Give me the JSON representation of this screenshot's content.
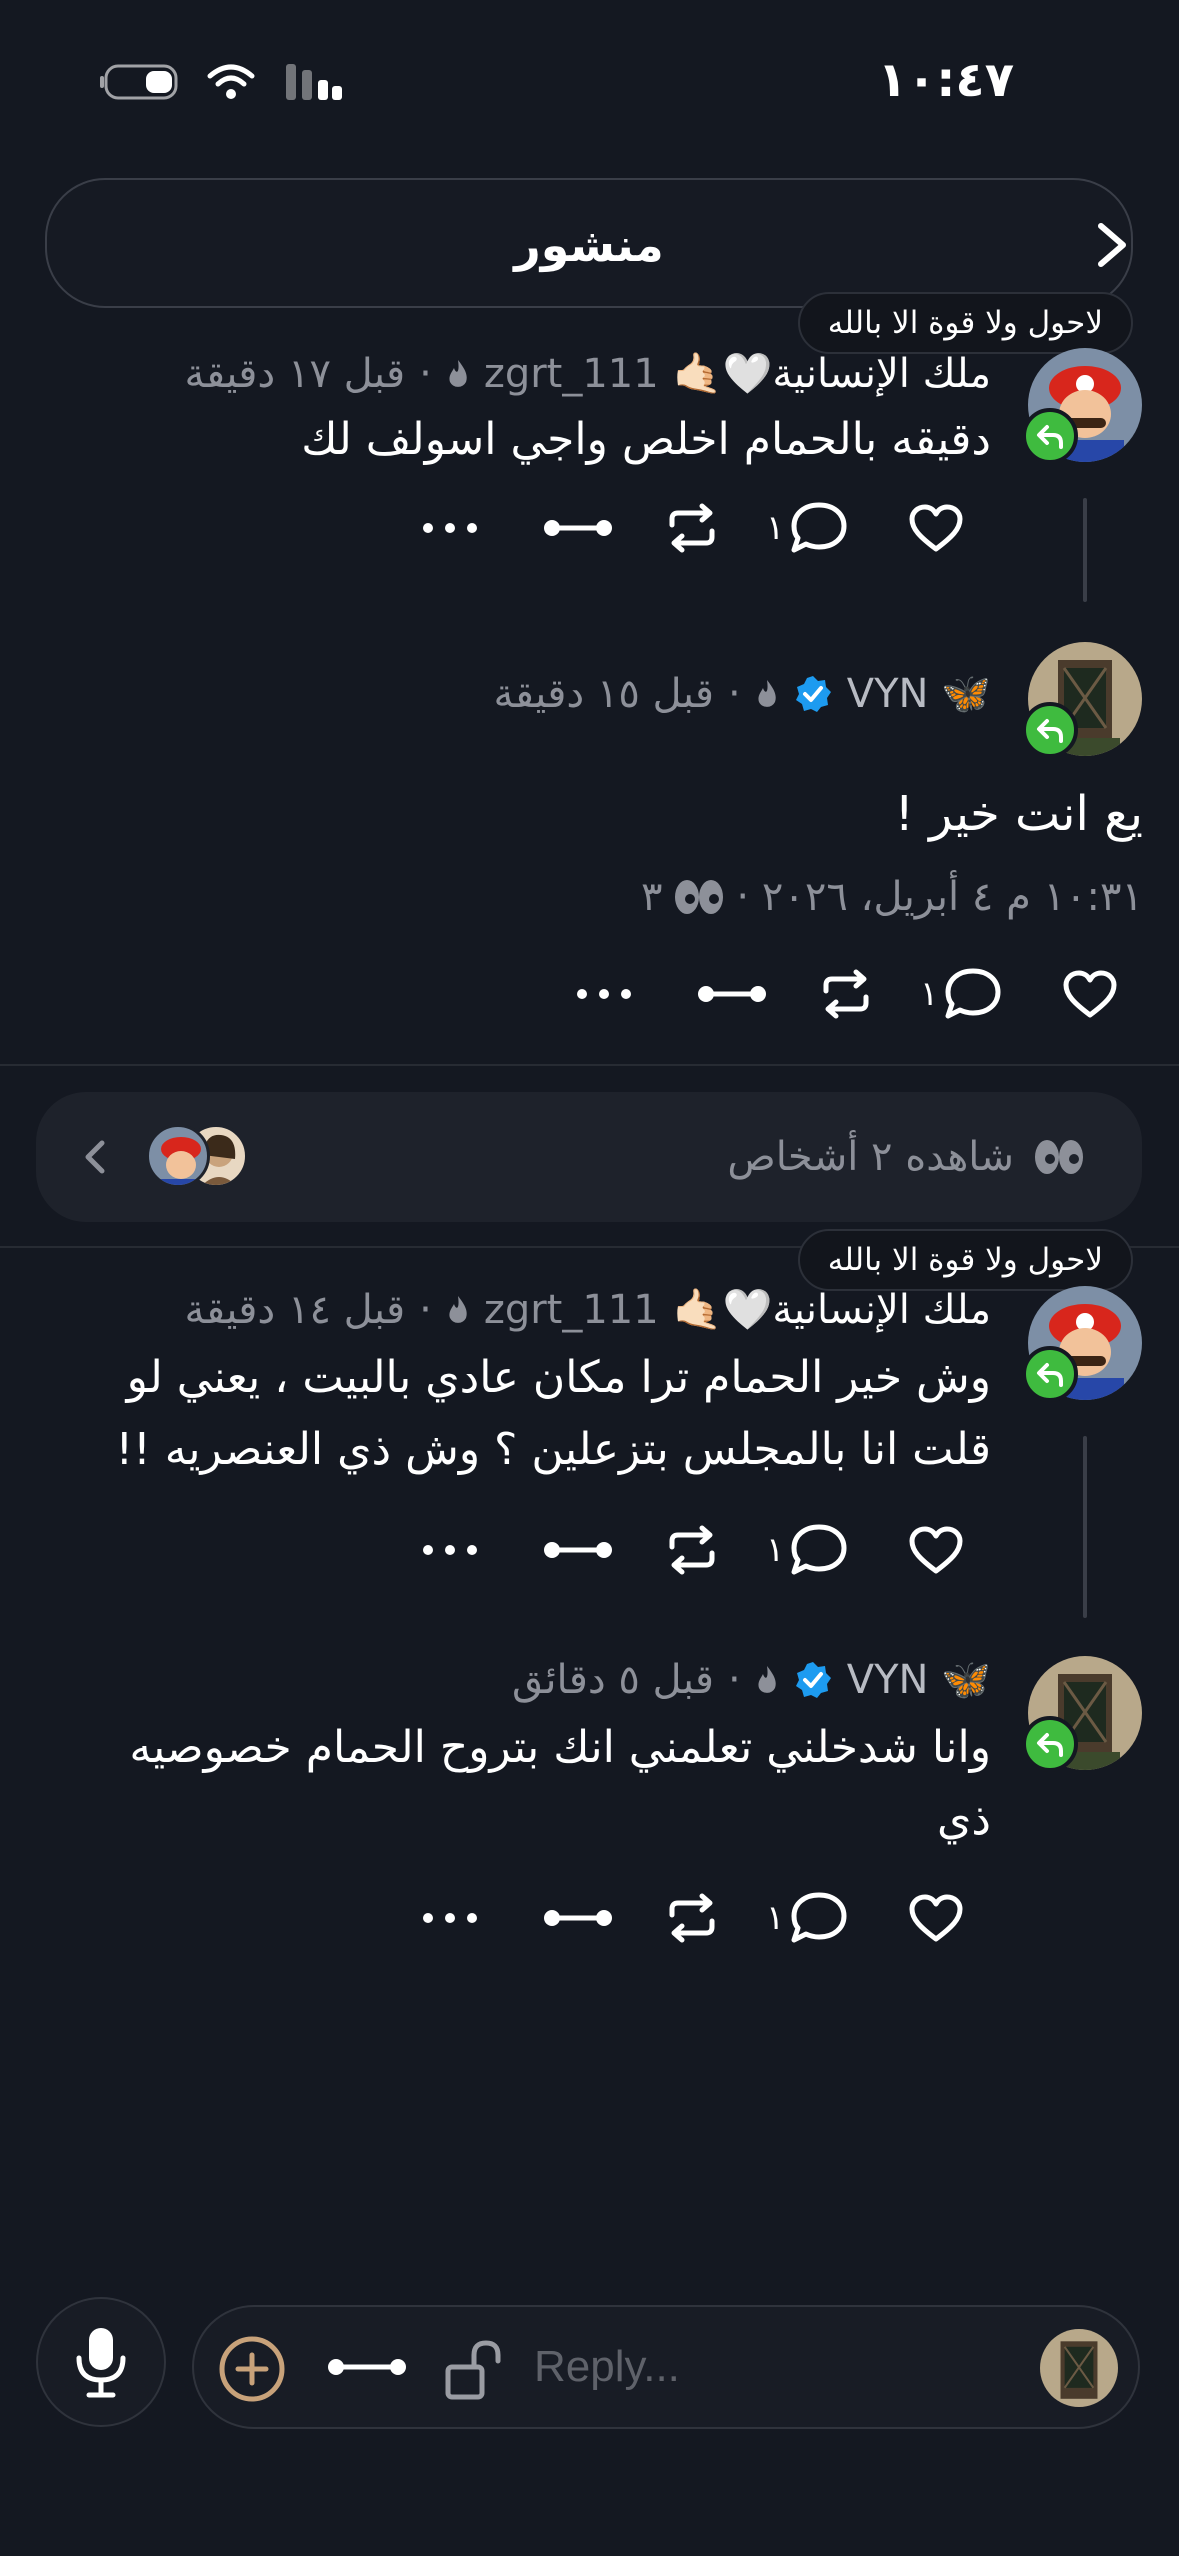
{
  "status_bar": {
    "time": "١٠:٤٧"
  },
  "header": {
    "title": "منشور"
  },
  "posts": [
    {
      "note": "لاحول ولا قوة الا بالله",
      "display_name": "ملك الإنسانية🤍🤙🏻",
      "handle": "zgrt_111",
      "time_ago": "قبل ١٧ دقيقة",
      "text": "دقيقه بالحمام اخلص واجي اسولف لك",
      "reply_count": "١"
    },
    {
      "display_name": "🦋 VYN",
      "verified": true,
      "time_ago": "قبل ١٥ دقيقة",
      "text": "يع انت خير !",
      "meta": "١٠:٣١ م ٤ أبريل، ٢٠٢٦ · ",
      "views": "٣",
      "reply_count": "١"
    },
    {
      "note": "لاحول ولا قوة الا بالله",
      "display_name": "ملك الإنسانية🤍🤙🏻",
      "handle": "zgrt_111",
      "time_ago": "قبل ١٤ دقيقة",
      "text_line1": "وش خير الحمام ترا مكان عادي بالبيت ، يعني لو",
      "text_line2": "قلت انا بالمجلس بتزعلين ؟ وش ذي العنصريه !!",
      "reply_count": "١"
    },
    {
      "display_name": "🦋 VYN",
      "verified": true,
      "time_ago": "قبل ٥ دقائق",
      "text_line1": "وانا شدخلني تعلمني انك بتروح الحمام خصوصيه",
      "text_line2": "ذي",
      "reply_count": "١"
    }
  ],
  "seen_by": {
    "text": "شاهده ٢ أشخاص"
  },
  "composer": {
    "placeholder": "Reply..."
  },
  "colors": {
    "background": "#141821",
    "accent_green": "#3fbb3f",
    "verified_blue": "#1d9bf0",
    "add_ring": "#c8a27a"
  },
  "icons": [
    "battery-icon",
    "wifi-icon",
    "signal-icon",
    "chevron-right-icon",
    "heart-icon",
    "comment-icon",
    "repost-icon",
    "link-icon",
    "more-icon",
    "eyes-icon",
    "mic-icon",
    "plus-icon",
    "unlock-icon"
  ]
}
